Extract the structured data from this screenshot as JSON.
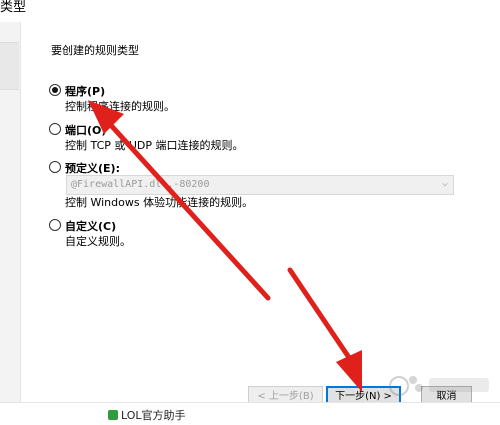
{
  "window": {
    "title": "类型"
  },
  "wizard": {
    "prompt": "要创建的规则类型",
    "options": [
      {
        "label": "程序(P)",
        "description": "控制程序连接的规则。",
        "checked": true
      },
      {
        "label": "端口(O)",
        "description": "控制 TCP 或 UDP 端口连接的规则。",
        "checked": false
      },
      {
        "label": "预定义(E):",
        "description": "控制 Windows 体验功能连接的规则。",
        "checked": false
      },
      {
        "label": "自定义(C)",
        "description": "自定义规则。",
        "checked": false
      }
    ],
    "predefined_dropdown": {
      "value": "@FirewallAPI.dll,-80200",
      "disabled": true
    },
    "buttons": {
      "back": "< 上一步(B)",
      "next": "下一步(N) >",
      "cancel": "取消"
    }
  },
  "taskbar": {
    "item_label": "LOL官方助手"
  },
  "colors": {
    "annotation_arrow": "#e0201b",
    "focus_border": "#0078d7"
  }
}
